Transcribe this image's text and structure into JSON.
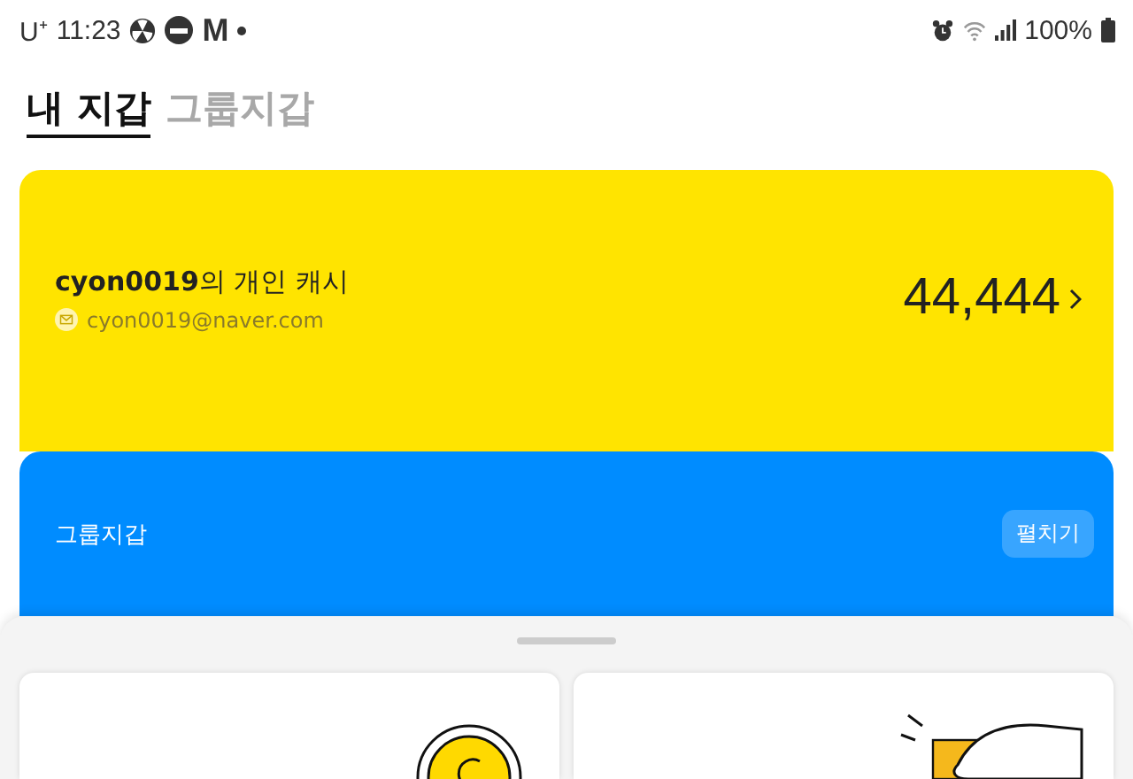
{
  "status_bar": {
    "carrier": "U⁺",
    "time": "11:23",
    "app_letter": "M",
    "battery": "100%"
  },
  "tabs": [
    {
      "label": "내 지갑",
      "selected": true
    },
    {
      "label": "그룹지갑",
      "selected": false
    }
  ],
  "personal_wallet": {
    "title": "**cyon0019**의 개인 캐시",
    "email": "cyon0019@naver.com",
    "balance": "44,444"
  },
  "group_wallet": {
    "title": "그룹지갑",
    "expand_button": "펼치기"
  }
}
